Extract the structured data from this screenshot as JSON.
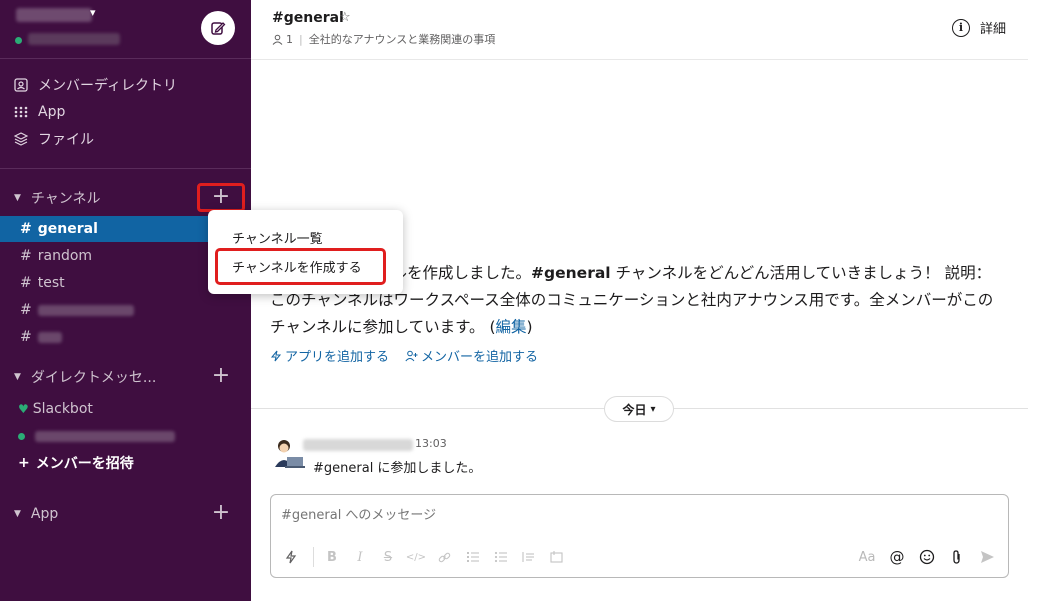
{
  "sidebar": {
    "nav": [
      {
        "label": "メンバーディレクトリ",
        "icon": "member-directory-icon"
      },
      {
        "label": "App",
        "icon": "apps-grid-icon"
      },
      {
        "label": "ファイル",
        "icon": "files-icon"
      }
    ],
    "channels_section": {
      "label": "チャンネル",
      "add": "+"
    },
    "channels": [
      {
        "hash": "#",
        "name": "general",
        "active": true
      },
      {
        "hash": "#",
        "name": "random"
      },
      {
        "hash": "#",
        "name": "test"
      },
      {
        "hash": "#",
        "name": ""
      },
      {
        "hash": "#",
        "name": ""
      }
    ],
    "dm_section": {
      "label": "ダイレクトメッセ...",
      "add": "+"
    },
    "dms": [
      {
        "name": "Slackbot"
      }
    ],
    "invite": {
      "plus": "+",
      "label": "メンバーを招待"
    },
    "app_section": {
      "label": "App",
      "add": "+"
    }
  },
  "dropdown": {
    "items": [
      "チャンネル一覧",
      "チャンネルを作成する"
    ]
  },
  "header": {
    "title": "#general",
    "star": "☆",
    "member_count": "1",
    "topic": "全社的なアナウンスと業務関連の事項",
    "details_label": "詳細",
    "details_icon": "i"
  },
  "intro": {
    "part1": "このチャンネルを作成しました。",
    "channel_bold": "#general",
    "part2": " チャンネルをどんどん活用していきましょう！ 説明： このチャンネルはワークスペース全体のコミュニケーションと社内アナウンス用です。全メンバーがこのチャンネルに参加しています。 (",
    "edit_link": "編集",
    "part3": ")",
    "add_app": "アプリを追加する",
    "add_member": "メンバーを追加する"
  },
  "divider": {
    "label": "今日",
    "caret": "⌄"
  },
  "message": {
    "time": "13:03",
    "text": "#general に参加しました。"
  },
  "composer": {
    "placeholder": "#general へのメッセージ",
    "right_aa": "Aa"
  },
  "colors": {
    "sidebar_bg": "#3f0e40",
    "active_channel": "#1164a3",
    "highlight_red": "#e01e1e",
    "link": "#1264a3",
    "presence": "#2bac76"
  }
}
